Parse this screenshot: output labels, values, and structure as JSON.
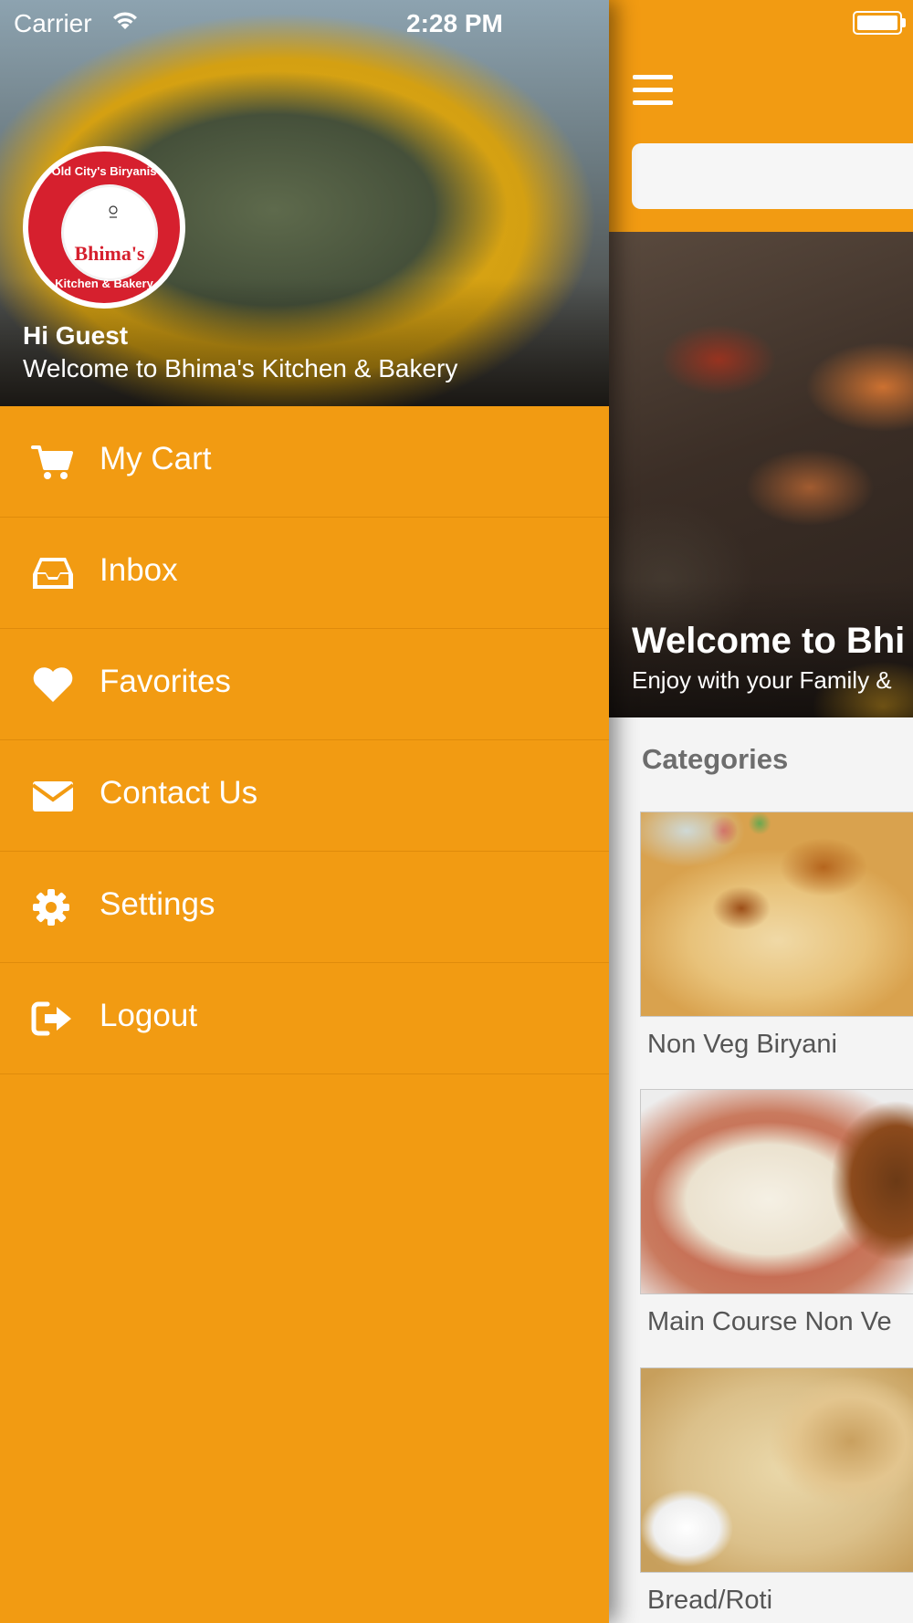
{
  "status_bar": {
    "carrier": "Carrier",
    "time": "2:28 PM"
  },
  "drawer": {
    "logo": {
      "name": "Bhima's",
      "top_text": "Old City's Biryanis",
      "bottom_text": "Kitchen & Bakery"
    },
    "greeting": "Hi Guest",
    "welcome": "Welcome to Bhima's Kitchen & Bakery",
    "items": [
      {
        "label": "My Cart",
        "icon": "cart-icon"
      },
      {
        "label": "Inbox",
        "icon": "inbox-icon"
      },
      {
        "label": "Favorites",
        "icon": "heart-icon"
      },
      {
        "label": "Contact Us",
        "icon": "envelope-icon"
      },
      {
        "label": "Settings",
        "icon": "gear-icon"
      },
      {
        "label": "Logout",
        "icon": "logout-icon"
      }
    ]
  },
  "main": {
    "search": {
      "value": "",
      "placeholder": ""
    },
    "hero": {
      "title": "Welcome to Bhi",
      "subtitle": "Enjoy with your Family &"
    },
    "categories_title": "Categories",
    "categories": [
      {
        "name": "Non Veg Biryani"
      },
      {
        "name": "Main Course Non Ve"
      },
      {
        "name": "Bread/Roti"
      }
    ]
  },
  "colors": {
    "accent": "#F29B12",
    "logo_red": "#D6202E",
    "text_gray": "#6D6D6D"
  }
}
